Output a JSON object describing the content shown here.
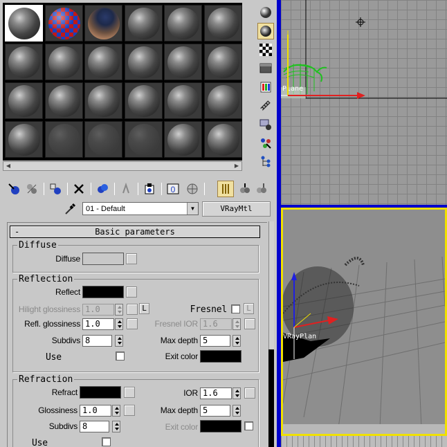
{
  "material": {
    "name": "01 - Default",
    "type_button": "VRayMtl"
  },
  "slots": {
    "rows": 4,
    "cols": 6,
    "special": {
      "0": "sphere-active",
      "1": "checker",
      "2": "environment"
    },
    "ghosted": [
      19,
      20,
      21
    ]
  },
  "rollout": {
    "collapse_glyph": "-",
    "title": "Basic parameters"
  },
  "diffuse": {
    "group_title": "Diffuse",
    "label": "Diffuse",
    "color": "#c8c8c8"
  },
  "reflection": {
    "group_title": "Reflection",
    "reflect_label": "Reflect",
    "reflect_color": "#000000",
    "hilight_label": "Hilight glossiness",
    "hilight_value": "1.0",
    "lock_label": "L",
    "fresnel_label": "Fresnel",
    "fresnel_lock": "L",
    "refl_gloss_label": "Refl. glossiness",
    "refl_gloss_value": "1.0",
    "fresnel_ior_label": "Fresnel IOR",
    "fresnel_ior_value": "1.6",
    "subdivs_label": "Subdivs",
    "subdivs_value": "8",
    "max_depth_label": "Max depth",
    "max_depth_value": "5",
    "use_label": "Use",
    "exit_color_label": "Exit color",
    "exit_color": "#000000"
  },
  "refraction": {
    "group_title": "Refraction",
    "refract_label": "Refract",
    "refract_color": "#000000",
    "ior_label": "IOR",
    "ior_value": "1.6",
    "gloss_label": "Glossiness",
    "gloss_value": "1.0",
    "max_depth_label": "Max depth",
    "max_depth_value": "5",
    "subdivs_label": "Subdivs",
    "subdivs_value": "8",
    "exit_color_label": "Exit color",
    "exit_color": "#000000",
    "use_label": "Use"
  },
  "viewport_top": {
    "object_label": "Plane"
  },
  "viewport_persp": {
    "object_label": "VRayPlan"
  },
  "colors": {
    "viewport_divider": "#0000cc",
    "active_viewport": "#f0e000",
    "axis_x": "#e02020",
    "axis_y": "#2020e0",
    "axis_z": "#f0e000",
    "teapot": "#20c020"
  }
}
